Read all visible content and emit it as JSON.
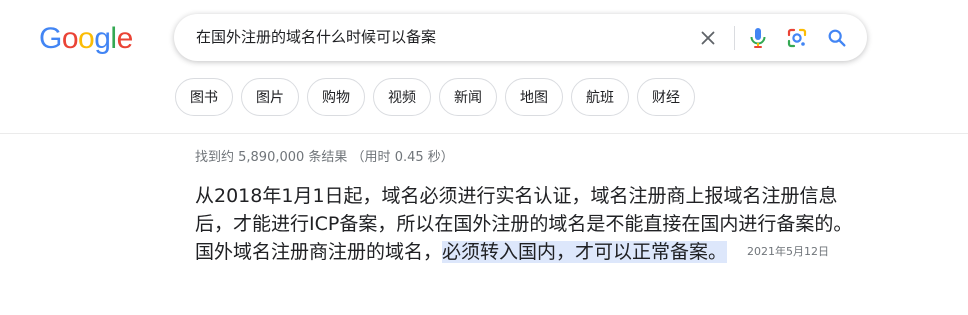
{
  "logo": {
    "letters": [
      "G",
      "o",
      "o",
      "g",
      "l",
      "e"
    ],
    "colors": [
      "#4285F4",
      "#EA4335",
      "#FBBC05",
      "#4285F4",
      "#34A853",
      "#EA4335"
    ]
  },
  "search": {
    "query": "在国外注册的域名什么时候可以备案"
  },
  "icons": {
    "clear": "close-icon",
    "mic": "microphone-icon",
    "lens": "google-lens-icon",
    "search": "search-icon"
  },
  "chips": [
    {
      "label": "图书"
    },
    {
      "label": "图片"
    },
    {
      "label": "购物"
    },
    {
      "label": "视频"
    },
    {
      "label": "新闻"
    },
    {
      "label": "地图"
    },
    {
      "label": "航班"
    },
    {
      "label": "财经"
    }
  ],
  "results": {
    "stats": "找到约 5,890,000 条结果 （用时 0.45 秒）"
  },
  "snippet": {
    "text_plain": "从2018年1月1日起，域名必须进行实名认证，域名注册商上报域名注册信息后，才能进行ICP备案，所以在国外注册的域名是不能直接在国内进行备案的。 国外域名注册商注册的域名，",
    "text_highlight": "必须转入国内，才可以正常备案",
    "text_end": "。",
    "date": "2021年5月12日"
  },
  "colors": {
    "highlight_bg": "#dde7fb",
    "secondary_text": "#70757a",
    "chip_border": "#dadce0",
    "search_blue": "#4285F4"
  }
}
